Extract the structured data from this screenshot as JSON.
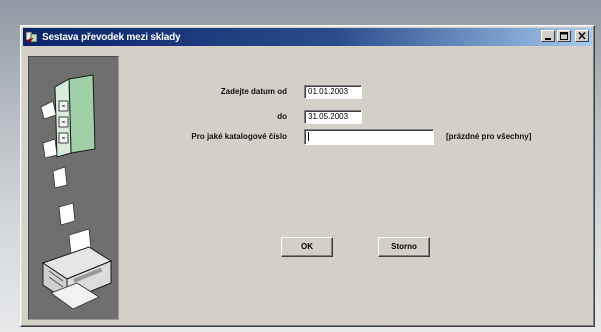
{
  "window": {
    "title": "Sestava převodek mezi sklady"
  },
  "form": {
    "date_from_label": "Zadejte datum od",
    "date_from_value": "01.01.2003",
    "date_to_label": "do",
    "date_to_value": "31.05.2003",
    "catalog_label": "Pro jaké katalogové číslo",
    "catalog_value": "",
    "catalog_hint": "[prázdné pro všechny]"
  },
  "buttons": {
    "ok": "OK",
    "cancel": "Storno"
  },
  "icons": {
    "app": "app-icon",
    "side_illustration": "printer-with-papers-illustration"
  }
}
